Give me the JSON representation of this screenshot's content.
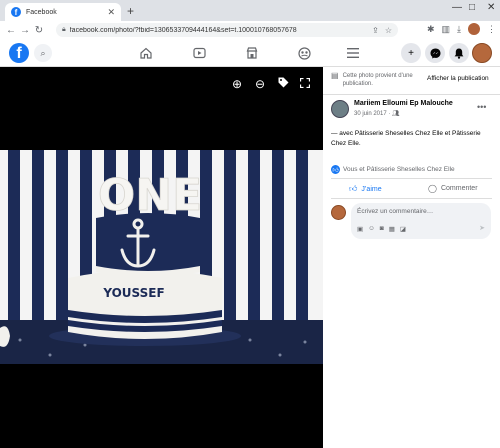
{
  "browser": {
    "tab_title": "Facebook",
    "tab_close": "✕",
    "new_tab": "+",
    "url": "facebook.com/photo/?fbid=1306533709444164&set=t.100010768057678",
    "win_min": "—",
    "win_max": "□",
    "win_close": "✕"
  },
  "fb": {
    "logo_letter": "f"
  },
  "panel": {
    "notice": "Cette photo provient d'une publication.",
    "add_to_pub": "Afficher la publication",
    "author": "Mariiem Elloumi Ep Malouche",
    "date": "30 juin 2017 · ",
    "caption": "— avec Pâtisserie Sheselles Chez Elle et Pâtisserie Chez Elle.",
    "reactions": "Vous et Pâtisserie Sheselles Chez Elle",
    "like_label": "J’aime",
    "comment_label": "Commenter",
    "comment_placeholder": "Écrivez un commentaire…"
  },
  "photo": {
    "cake_top_text": "ONE",
    "cake_name": "YOUSSEF"
  },
  "colors": {
    "accent": "#1877f2",
    "cake_navy": "#1b2a55"
  }
}
